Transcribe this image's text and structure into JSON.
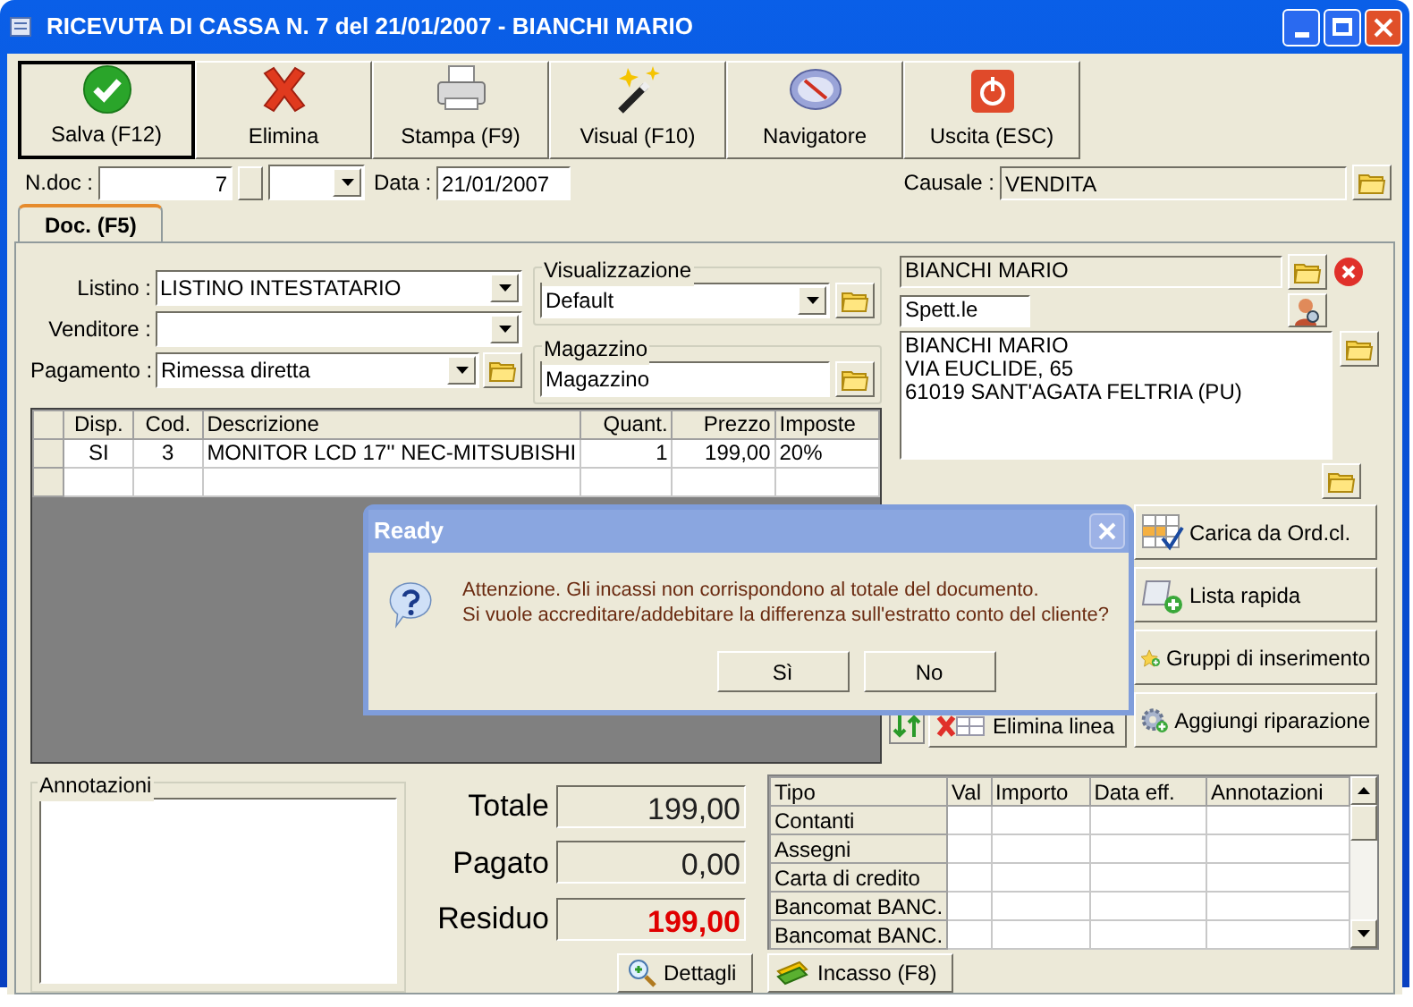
{
  "window": {
    "title": "RICEVUTA DI CASSA N. 7  del 21/01/2007 - BIANCHI MARIO"
  },
  "toolbar": [
    {
      "label": "Salva (F12)"
    },
    {
      "label": "Elimina"
    },
    {
      "label": "Stampa (F9)"
    },
    {
      "label": "Visual (F10)"
    },
    {
      "label": "Navigatore"
    },
    {
      "label": "Uscita (ESC)"
    }
  ],
  "header": {
    "ndoc_label": "N.doc :",
    "ndoc_value": "7",
    "data_label": "Data :",
    "data_value": "21/01/2007",
    "causale_label": "Causale :",
    "causale_value": "VENDITA"
  },
  "tabs": [
    {
      "label": "Doc. (F5)",
      "selected": true
    }
  ],
  "form": {
    "listino_label": "Listino :",
    "listino_value": "LISTINO INTESTATARIO",
    "venditore_label": "Venditore :",
    "pagamento_label": "Pagamento :",
    "pagamento_value": "Rimessa diretta"
  },
  "visualizzazione": {
    "title": "Visualizzazione",
    "value": "Default"
  },
  "magazzino": {
    "title": "Magazzino",
    "value": "Magazzino"
  },
  "items_table": {
    "columns": [
      "Disp.",
      "Cod.",
      "Descrizione",
      "Quant.",
      "Prezzo",
      "Imposte"
    ],
    "rows": [
      [
        "SI",
        "3",
        "MONITOR LCD 17'' NEC-MITSUBISHI",
        "1",
        "199,00",
        "20%"
      ]
    ]
  },
  "client": {
    "name": "BIANCHI MARIO",
    "salutation": "Spett.le",
    "address": [
      "BIANCHI MARIO",
      "VIA EUCLIDE, 65",
      "61019 SANT'AGATA FELTRIA (PU)"
    ]
  },
  "side_buttons": [
    {
      "label": "Carica da Ord.cl."
    },
    {
      "label": "Lista rapida"
    },
    {
      "label": "Gruppi di inserimento"
    },
    {
      "label": "Aggiungi riparazione"
    }
  ],
  "elimina_linea": {
    "label": "Elimina linea"
  },
  "annotazioni": {
    "title": "Annotazioni"
  },
  "totals": [
    {
      "label": "Totale",
      "value": "199,00",
      "emphasis": false
    },
    {
      "label": "Pagato",
      "value": "0,00",
      "emphasis": false
    },
    {
      "label": "Residuo",
      "value": "199,00",
      "emphasis": true
    }
  ],
  "dettagli": {
    "label": "Dettagli"
  },
  "payments": {
    "columns": [
      "Tipo",
      "Val",
      "Importo",
      "Data eff.",
      "Annotazioni"
    ],
    "rows": [
      "Contanti",
      "Assegni",
      "Carta di credito",
      "Bancomat BANC.",
      "Bancomat BANC."
    ]
  },
  "incasso": {
    "label": "Incasso (F8)"
  },
  "dialog": {
    "title": "Ready",
    "message": [
      "Attenzione. Gli incassi non corrispondono al totale del documento.",
      "Si vuole accreditare/addebitare la differenza sull'estratto conto del cliente?"
    ],
    "buttons": [
      "Sì",
      "No"
    ]
  }
}
